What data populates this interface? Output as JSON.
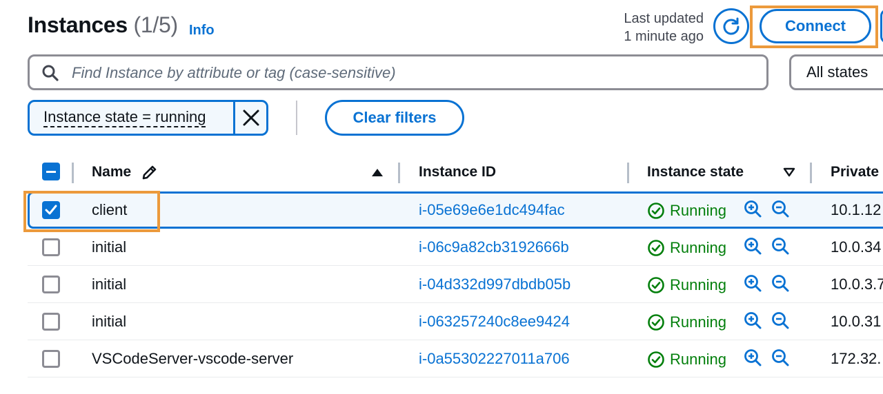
{
  "header": {
    "title": "Instances",
    "count": "(1/5)",
    "info": "Info",
    "last_updated_line1": "Last updated",
    "last_updated_line2": "1 minute ago",
    "connect_label": "Connect"
  },
  "search": {
    "placeholder": "Find Instance by attribute or tag (case-sensitive)",
    "states_select": "All states"
  },
  "filters": {
    "token": "Instance state = running",
    "clear_label": "Clear filters"
  },
  "columns": {
    "name": "Name",
    "instance_id": "Instance ID",
    "instance_state": "Instance state",
    "private": "Private"
  },
  "rows": [
    {
      "name": "client",
      "instance_id": "i-05e69e6e1dc494fac",
      "state": "Running",
      "private_ip": "10.1.12",
      "selected": true
    },
    {
      "name": "initial",
      "instance_id": "i-06c9a82cb3192666b",
      "state": "Running",
      "private_ip": "10.0.34",
      "selected": false
    },
    {
      "name": "initial",
      "instance_id": "i-04d332d997dbdb05b",
      "state": "Running",
      "private_ip": "10.0.3.7",
      "selected": false
    },
    {
      "name": "initial",
      "instance_id": "i-063257240c8ee9424",
      "state": "Running",
      "private_ip": "10.0.31",
      "selected": false
    },
    {
      "name": "VSCodeServer-vscode-server",
      "instance_id": "i-0a55302227011a706",
      "state": "Running",
      "private_ip": "172.32.",
      "selected": false
    }
  ],
  "colors": {
    "link": "#0972d3",
    "success": "#037f0c",
    "highlight": "#ec9a3c",
    "border": "#8c8c94"
  },
  "icons": [
    "search-icon",
    "refresh-icon",
    "close-icon",
    "pencil-icon",
    "sort-ascending-icon",
    "sort-descending-icon",
    "status-ok-icon",
    "zoom-in-icon",
    "zoom-out-icon",
    "checkmark-icon"
  ]
}
